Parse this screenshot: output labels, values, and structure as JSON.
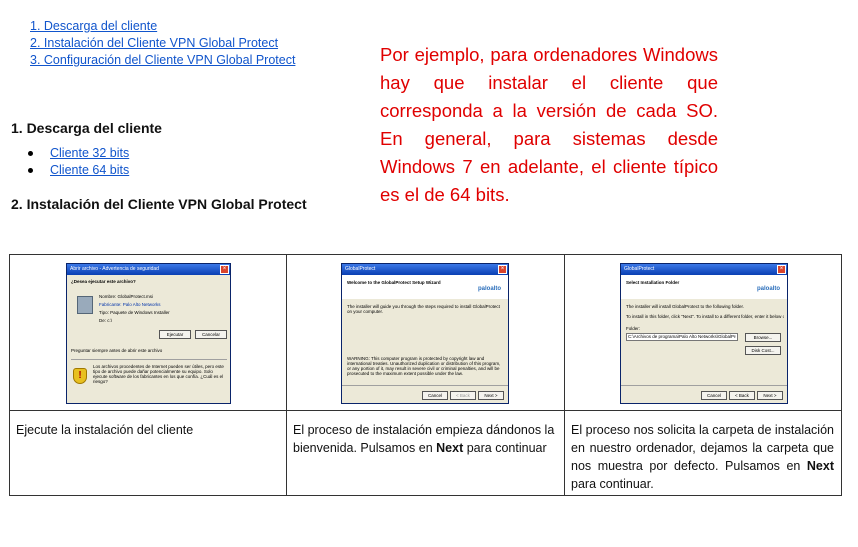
{
  "toc": {
    "items": [
      "1. Descarga del cliente",
      "2. Instalación del Cliente VPN Global Protect",
      "3. Configuración del Cliente VPN Global Protect"
    ]
  },
  "section1": {
    "heading": "1. Descarga del cliente",
    "links": [
      "Cliente 32 bits",
      "Cliente 64 bits"
    ]
  },
  "section2": {
    "heading": "2. Instalación del Cliente VPN Global Protect"
  },
  "note": {
    "text": "Por ejemplo, para ordenadores Windows hay que instalar el cliente que corresponda a la versión de cada SO. En general, para sistemas desde Windows 7 en adelante, el cliente típico es el de 64 bits."
  },
  "table": {
    "shots": {
      "s1": {
        "title": "Abrir archivo - Advertencia de seguridad",
        "question": "¿Desea ejecutar este archivo?",
        "fields": [
          "Nombre: GlobalProtect.msi",
          "Fabricante: Palo Alto Networks",
          "Tipo: Paquete de Windows Installer",
          "De: c:\\"
        ],
        "run": "Ejecutar",
        "cancel": "Cancelar",
        "checkbox": "Preguntar siempre antes de abrir este archivo",
        "warning": "Los archivos procedentes de Internet pueden ser útiles, pero este tipo de archivo puede dañar potencialmente su equipo. Solo ejecute software de los fabricantes en los que confía. ¿Cuál es el riesgo?"
      },
      "s2": {
        "title": "GlobalProtect",
        "header": "Welcome to the GlobalProtect Setup Wizard",
        "logo": "paloalto",
        "body": "The installer will guide you through the steps required to install GlobalProtect on your computer.",
        "warning": "WARNING: This computer program is protected by copyright law and international treaties. Unauthorized duplication or distribution of this program, or any portion of it, may result in severe civil or criminal penalties, and will be prosecuted to the maximum extent possible under the law.",
        "buttons": [
          "Cancel",
          "< Back",
          "Next >"
        ]
      },
      "s3": {
        "title": "GlobalProtect",
        "header": "Select Installation Folder",
        "logo": "paloalto",
        "body1": "The installer will install GlobalProtect to the following folder.",
        "body2": "To install in this folder, click \"Next\". To install to a different folder, enter it below or click \"Browse\".",
        "folder_label": "Folder:",
        "folder_value": "C:\\Archivos de programa\\Palo Alto Networks\\GlobalProtect\\",
        "browse": "Browse...",
        "disk_cost": "Disk Cost...",
        "buttons": [
          "Cancel",
          "< Back",
          "Next >"
        ]
      }
    },
    "captions": {
      "c1": "Ejecute la instalación del cliente",
      "c2_pre": "El proceso de instalación empieza dándonos la bienvenida. Pulsamos en ",
      "c2_bold": "Next",
      "c2_post": " para continuar",
      "c3_pre": "El proceso nos solicita la carpeta de instalación en nuestro ordenador, dejamos la carpeta que nos muestra por defecto. Pulsamos en ",
      "c3_bold": "Next",
      "c3_post": " para continuar."
    }
  }
}
